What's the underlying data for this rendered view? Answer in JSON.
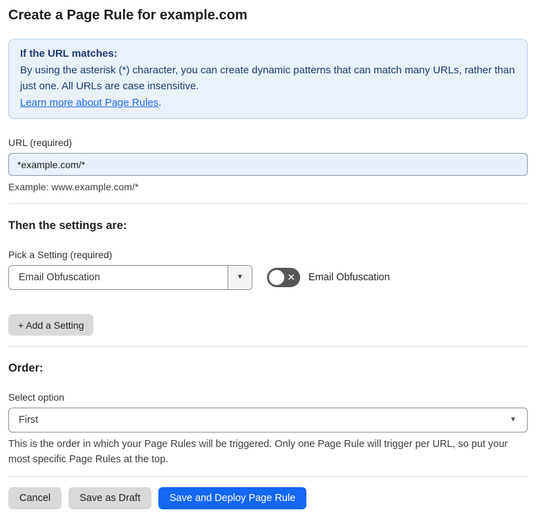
{
  "page": {
    "title": "Create a Page Rule for example.com"
  },
  "info_box": {
    "heading": "If the URL matches:",
    "body": "By using the asterisk (*) character, you can create dynamic patterns that can match many URLs, rather than just one. All URLs are case insensitive.",
    "link_label": "Learn more about Page Rules",
    "link_suffix": "."
  },
  "url_field": {
    "label": "URL (required)",
    "value": "*example.com/*",
    "helper": "Example: www.example.com/*"
  },
  "settings_section": {
    "heading": "Then the settings are:",
    "picker_label": "Pick a Setting (required)",
    "selected_setting": "Email Obfuscation",
    "select_chevron": "▼",
    "toggle_state": "off",
    "toggle_icon_glyph": "✕",
    "toggle_label": "Email Obfuscation",
    "add_button_label": "+ Add a Setting"
  },
  "order_section": {
    "heading": "Order:",
    "select_label": "Select option",
    "selected_option": "First",
    "select_chevron": "▼",
    "helper": "This is the order in which your Page Rules will be triggered. Only one Page Rule will trigger per URL, so put your most specific Page Rules at the top."
  },
  "footer": {
    "cancel_label": "Cancel",
    "save_draft_label": "Save as Draft",
    "save_deploy_label": "Save and Deploy Page Rule"
  },
  "colors": {
    "info_box_bg": "#e9f1fb",
    "info_box_border": "#b9d1ec",
    "info_text": "#1b3c6d",
    "link": "#1f6ae8",
    "input_autofill_bg": "#e8f0fe",
    "toggle_off_bg": "#575757",
    "secondary_button_bg": "#d9d9d9",
    "primary_button_bg": "#1467f2",
    "divider": "#dcdcdc"
  }
}
